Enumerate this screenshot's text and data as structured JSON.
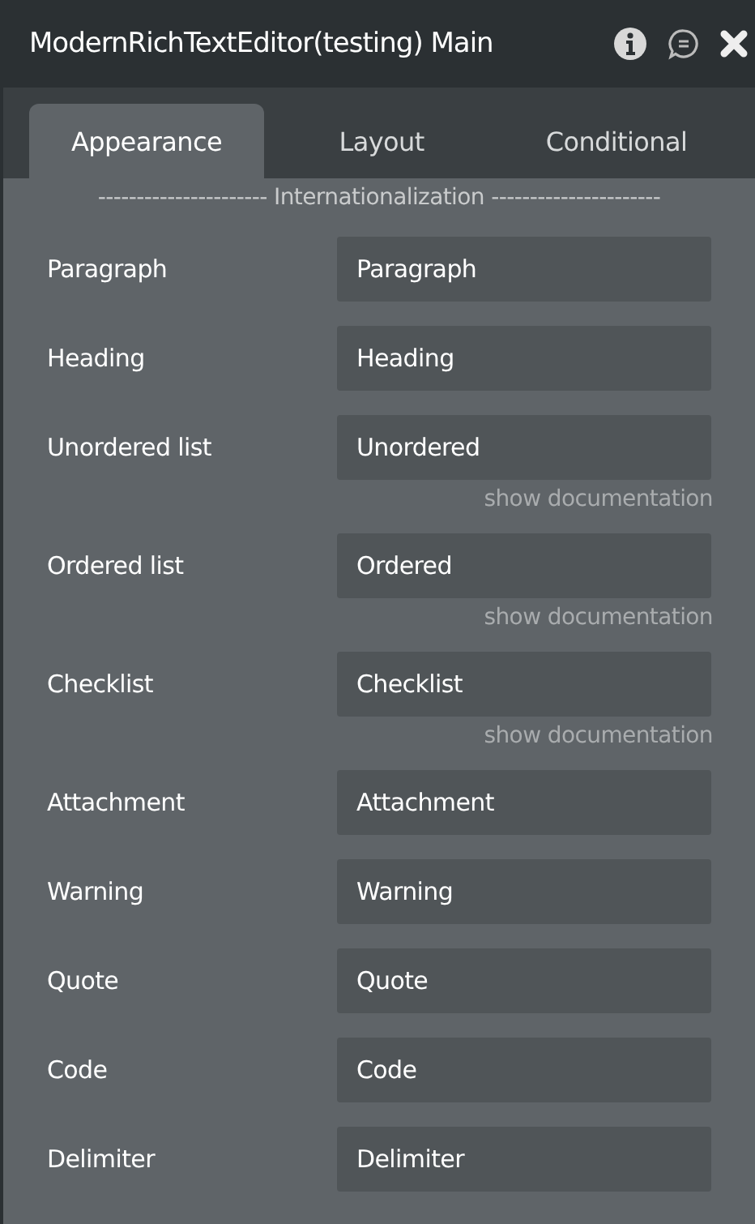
{
  "window": {
    "title": "ModernRichTextEditor(testing) Main"
  },
  "tabs": [
    {
      "label": "Appearance",
      "selected": true
    },
    {
      "label": "Layout",
      "selected": false
    },
    {
      "label": "Conditional",
      "selected": false
    }
  ],
  "section_header": "---------------------- Internationalization ----------------------",
  "fields": [
    {
      "label": "Paragraph",
      "value": "Paragraph"
    },
    {
      "label": "Heading",
      "value": "Heading"
    },
    {
      "label": "Unordered list",
      "value": "Unordered",
      "doc_link": "show documentation"
    },
    {
      "label": "Ordered list",
      "value": "Ordered",
      "doc_link": "show documentation"
    },
    {
      "label": "Checklist",
      "value": "Checklist",
      "doc_link": "show documentation"
    },
    {
      "label": "Attachment",
      "value": "Attachment"
    },
    {
      "label": "Warning",
      "value": "Warning"
    },
    {
      "label": "Quote",
      "value": "Quote"
    },
    {
      "label": "Code",
      "value": "Code"
    },
    {
      "label": "Delimiter",
      "value": "Delimiter"
    }
  ]
}
